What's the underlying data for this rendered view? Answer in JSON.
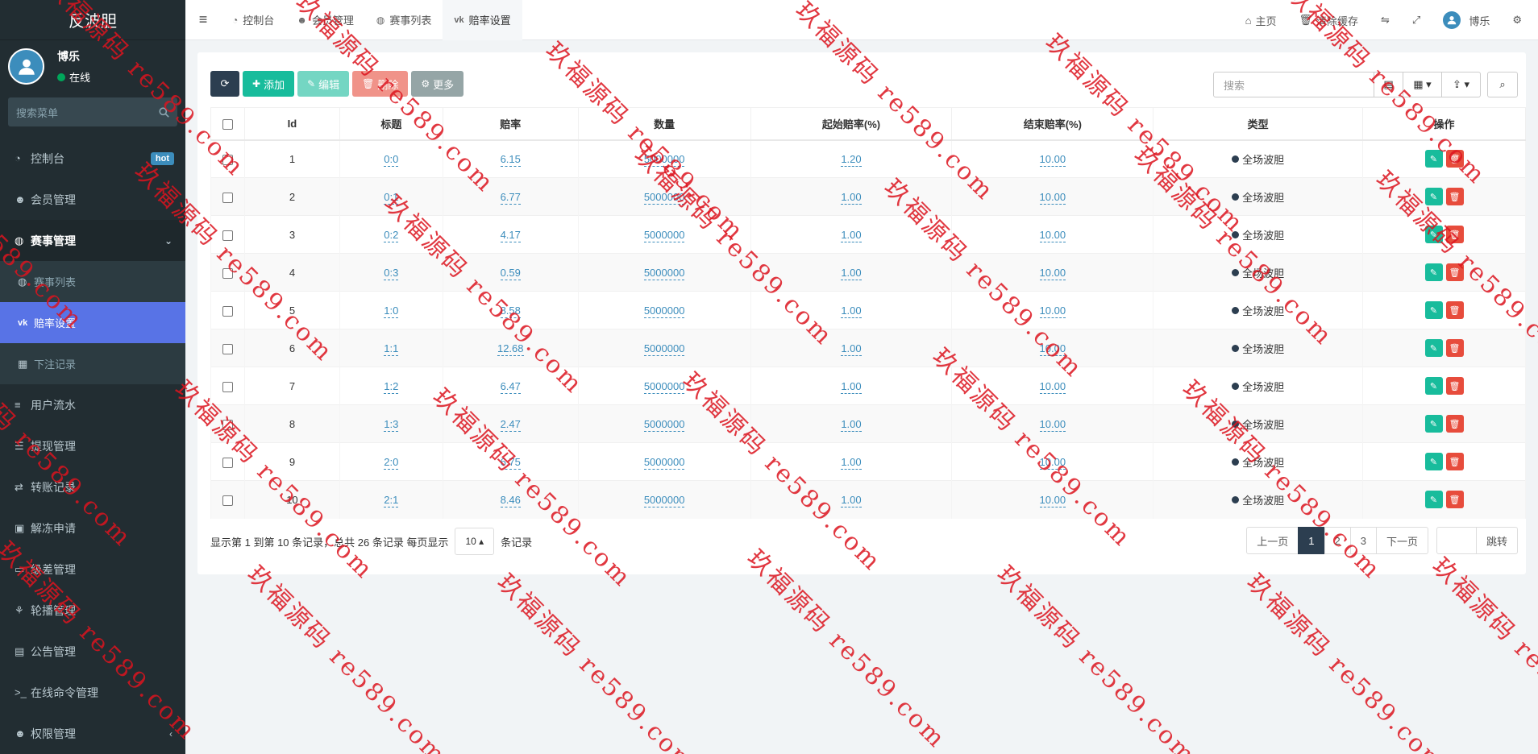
{
  "app": {
    "title": "反波胆"
  },
  "user": {
    "name": "博乐",
    "status": "在线"
  },
  "sidebar": {
    "search_placeholder": "搜索菜单",
    "items": [
      {
        "label": "控制台",
        "icon": "dashboard-icon",
        "badge": "hot"
      },
      {
        "label": "会员管理",
        "icon": "users-icon"
      },
      {
        "label": "赛事管理",
        "icon": "globe-icon"
      },
      {
        "label": "赛事列表",
        "icon": "globe-icon"
      },
      {
        "label": "赔率设置",
        "icon": "vk-icon"
      },
      {
        "label": "下注记录",
        "icon": "calendar-icon"
      },
      {
        "label": "用户流水",
        "icon": "list-icon"
      },
      {
        "label": "提现管理",
        "icon": "list-alt-icon"
      },
      {
        "label": "转账记录",
        "icon": "transfer-icon"
      },
      {
        "label": "解冻申请",
        "icon": "picture-icon"
      },
      {
        "label": "级差管理",
        "icon": "window-icon"
      },
      {
        "label": "轮播管理",
        "icon": "balloon-icon"
      },
      {
        "label": "公告管理",
        "icon": "notice-icon"
      },
      {
        "label": "在线命令管理",
        "icon": "terminal-icon"
      },
      {
        "label": "权限管理",
        "icon": "group-icon"
      }
    ]
  },
  "topnav": {
    "tabs": [
      {
        "label": "控制台",
        "icon": "dashboard-icon"
      },
      {
        "label": "会员管理",
        "icon": "users-icon"
      },
      {
        "label": "赛事列表",
        "icon": "globe-icon"
      },
      {
        "label": "赔率设置",
        "icon": "vk-icon"
      }
    ],
    "home": "主页",
    "clear_cache": "清除缓存",
    "username": "博乐"
  },
  "toolbar": {
    "add": "添加",
    "edit": "编辑",
    "delete": "删除",
    "more": "更多",
    "search_placeholder": "搜索"
  },
  "table": {
    "headers": [
      "Id",
      "标题",
      "赔率",
      "数量",
      "起始赔率(%)",
      "结束赔率(%)",
      "类型",
      "操作"
    ],
    "rows": [
      {
        "id": "1",
        "title": "0:0",
        "odds": "6.15",
        "qty": "5000000",
        "start": "1.20",
        "end": "10.00",
        "type": "全场波胆"
      },
      {
        "id": "2",
        "title": "0:1",
        "odds": "6.77",
        "qty": "5000000",
        "start": "1.00",
        "end": "10.00",
        "type": "全场波胆"
      },
      {
        "id": "3",
        "title": "0:2",
        "odds": "4.17",
        "qty": "5000000",
        "start": "1.00",
        "end": "10.00",
        "type": "全场波胆"
      },
      {
        "id": "4",
        "title": "0:3",
        "odds": "0.59",
        "qty": "5000000",
        "start": "1.00",
        "end": "10.00",
        "type": "全场波胆"
      },
      {
        "id": "5",
        "title": "1:0",
        "odds": "8.58",
        "qty": "5000000",
        "start": "1.00",
        "end": "10.00",
        "type": "全场波胆"
      },
      {
        "id": "6",
        "title": "1:1",
        "odds": "12.68",
        "qty": "5000000",
        "start": "1.00",
        "end": "10.00",
        "type": "全场波胆"
      },
      {
        "id": "7",
        "title": "1:2",
        "odds": "6.47",
        "qty": "5000000",
        "start": "1.00",
        "end": "10.00",
        "type": "全场波胆"
      },
      {
        "id": "8",
        "title": "1:3",
        "odds": "2.47",
        "qty": "5000000",
        "start": "1.00",
        "end": "10.00",
        "type": "全场波胆"
      },
      {
        "id": "9",
        "title": "2:0",
        "odds": "6.75",
        "qty": "5000000",
        "start": "1.00",
        "end": "10.00",
        "type": "全场波胆"
      },
      {
        "id": "10",
        "title": "2:1",
        "odds": "8.46",
        "qty": "5000000",
        "start": "1.00",
        "end": "10.00",
        "type": "全场波胆"
      }
    ]
  },
  "footer": {
    "summary": "显示第 1 到第 10 条记录，总共 26 条记录 每页显示",
    "page_size": "10",
    "suffix": "条记录"
  },
  "pagination": {
    "prev": "上一页",
    "pages": [
      "1",
      "2",
      "3"
    ],
    "current": "1",
    "next": "下一页",
    "jump": "跳转"
  },
  "watermark": {
    "text": "玖福源码 re589.com"
  },
  "colors": {
    "sidebar_bg": "#222d32",
    "active_menu": "#5873e6",
    "primary": "#18bc9c",
    "danger": "#e74c3c",
    "link": "#3c8dbc"
  }
}
